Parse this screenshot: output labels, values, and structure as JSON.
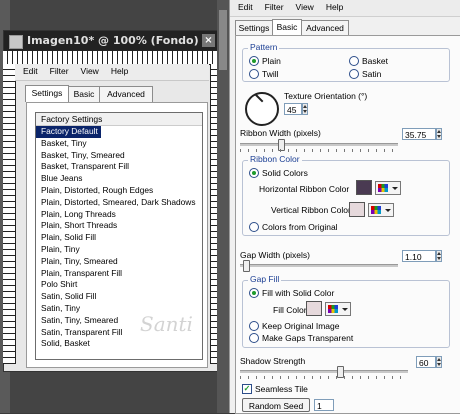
{
  "left_window": {
    "title": "Imagen10* @ 100% (Fondo)",
    "menu": [
      "Edit",
      "Filter",
      "View",
      "Help"
    ],
    "tabs": [
      "Settings",
      "Basic",
      "Advanced"
    ],
    "list_header": "Factory Settings",
    "presets": [
      "Factory Default",
      "Basket, Tiny",
      "Basket, Tiny, Smeared",
      "Basket, Transparent Fill",
      "Blue Jeans",
      "Plain, Distorted, Rough Edges",
      "Plain, Distorted, Smeared, Dark Shadows",
      "Plain, Long Threads",
      "Plain, Short Threads",
      "Plain, Solid Fill",
      "Plain, Tiny",
      "Plain, Tiny, Smeared",
      "Plain, Transparent Fill",
      "Polo Shirt",
      "Satin, Solid Fill",
      "Satin, Tiny",
      "Satin, Tiny, Smeared",
      "Satin, Transparent Fill",
      "Solid, Basket"
    ],
    "selected_preset": "Factory Default"
  },
  "right_window": {
    "menu": [
      "Edit",
      "Filter",
      "View",
      "Help"
    ],
    "tabs": [
      "Settings",
      "Basic",
      "Advanced"
    ],
    "active_tab": "Basic",
    "pattern": {
      "title": "Pattern",
      "options": [
        "Plain",
        "Basket",
        "Twill",
        "Satin"
      ],
      "selected": "Plain"
    },
    "texture_orientation": {
      "label": "Texture Orientation (°)",
      "value": "45"
    },
    "ribbon_width": {
      "label": "Ribbon Width (pixels)",
      "value": "35.75",
      "fraction": 0.25
    },
    "ribbon_color": {
      "title": "Ribbon Color",
      "solid_label": "Solid Colors",
      "horizontal_label": "Horizontal Ribbon Color",
      "vertical_label": "Vertical Ribbon Color",
      "from_original_label": "Colors from Original",
      "horizontal_color": "#4a3a52",
      "vertical_color": "#e6d9dc"
    },
    "gap_width": {
      "label": "Gap Width (pixels)",
      "value": "1.10",
      "fraction": 0.02
    },
    "gap_fill": {
      "title": "Gap Fill",
      "fill_solid_label": "Fill with Solid Color",
      "fill_color_label": "Fill Color",
      "fill_color": "#e6d9dc",
      "keep_original_label": "Keep Original Image",
      "make_transparent_label": "Make Gaps Transparent"
    },
    "shadow_strength": {
      "label": "Shadow Strength",
      "value": "60",
      "fraction": 0.6
    },
    "seamless_tile": {
      "label": "Seamless Tile",
      "checked": true
    },
    "random_seed": {
      "button_label": "Random Seed",
      "value": "1"
    }
  },
  "watermark": "Santi"
}
